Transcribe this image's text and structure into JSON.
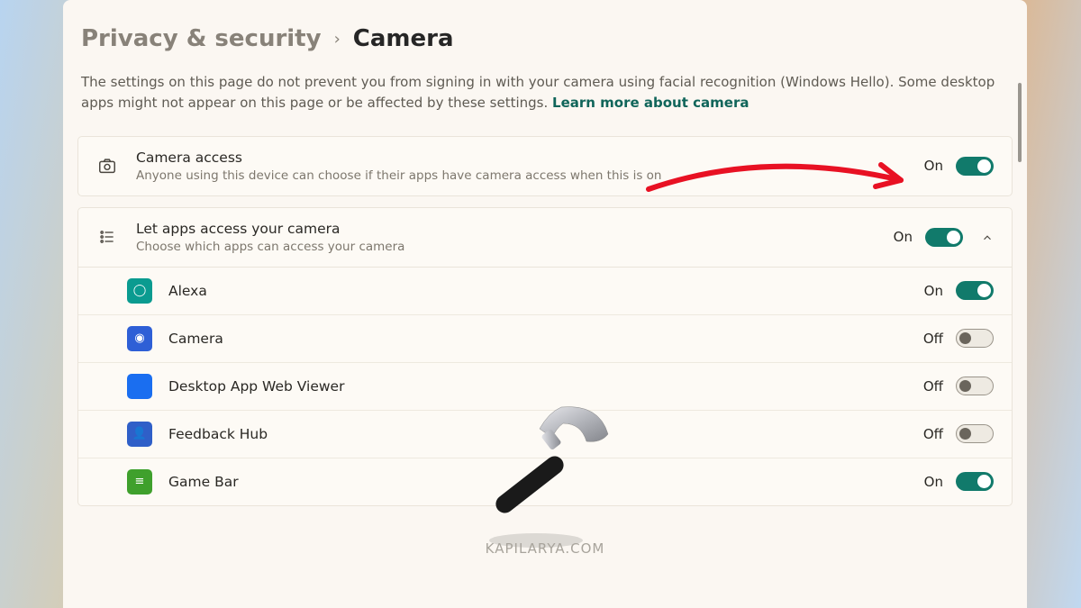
{
  "breadcrumb": {
    "parent": "Privacy & security",
    "current": "Camera"
  },
  "intro": {
    "text": "The settings on this page do not prevent you from signing in with your camera using facial recognition (Windows Hello). Some desktop apps might not appear on this page or be affected by these settings.  ",
    "link": "Learn more about camera"
  },
  "camera_access": {
    "title": "Camera access",
    "sub": "Anyone using this device can choose if their apps have camera access when this is on",
    "state": "On",
    "on": true
  },
  "let_apps": {
    "title": "Let apps access your camera",
    "sub": "Choose which apps can access your camera",
    "state": "On",
    "on": true
  },
  "apps": [
    {
      "name": "Alexa",
      "state": "On",
      "on": true,
      "icon_bg": "#0a9b90",
      "glyph": "◯"
    },
    {
      "name": "Camera",
      "state": "Off",
      "on": false,
      "icon_bg": "#2e5fd6",
      "glyph": "◉"
    },
    {
      "name": "Desktop App Web Viewer",
      "state": "Off",
      "on": false,
      "icon_bg": "#1a6ef0",
      "glyph": ""
    },
    {
      "name": "Feedback Hub",
      "state": "Off",
      "on": false,
      "icon_bg": "#2f5fc8",
      "glyph": "👤"
    },
    {
      "name": "Game Bar",
      "state": "On",
      "on": true,
      "icon_bg": "#3fa02c",
      "glyph": "≡"
    }
  ],
  "watermark": "KAPILARYA.COM"
}
